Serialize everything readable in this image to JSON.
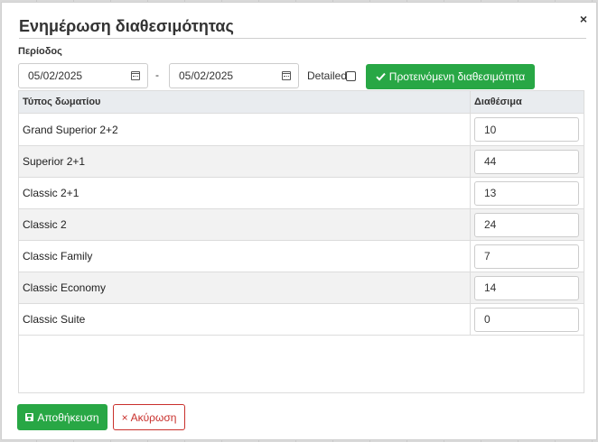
{
  "dialog": {
    "title": "Ενημέρωση διαθεσιμότητας",
    "close_glyph": "×"
  },
  "period": {
    "label": "Περίοδος",
    "from_date": "05/02/2025",
    "separator": "-",
    "to_date": "05/02/2025",
    "detailed_label": "Detailed",
    "detailed_checked": false,
    "suggest_icon": "check-icon",
    "suggest_label": "Προτεινόμενη διαθεσιμότητα"
  },
  "table": {
    "headers": {
      "room_type": "Τύπος δωματίου",
      "available": "Διαθέσιμα"
    },
    "rows": [
      {
        "room_type": "Grand Superior 2+2",
        "available": "10"
      },
      {
        "room_type": "Superior 2+1",
        "available": "44"
      },
      {
        "room_type": "Classic 2+1",
        "available": "13"
      },
      {
        "room_type": "Classic 2",
        "available": "24"
      },
      {
        "room_type": "Classic Family",
        "available": "7"
      },
      {
        "room_type": "Classic Economy",
        "available": "14"
      },
      {
        "room_type": "Classic Suite",
        "available": "0"
      }
    ]
  },
  "footer": {
    "save_icon": "floppy-disk-icon",
    "save_label": "Αποθήκευση",
    "cancel_icon": "close-icon",
    "cancel_glyph": "×",
    "cancel_label": "Ακύρωση"
  },
  "colors": {
    "success_green": "#28a745",
    "danger_red": "#c9302c",
    "header_gray": "#e9ecef"
  }
}
